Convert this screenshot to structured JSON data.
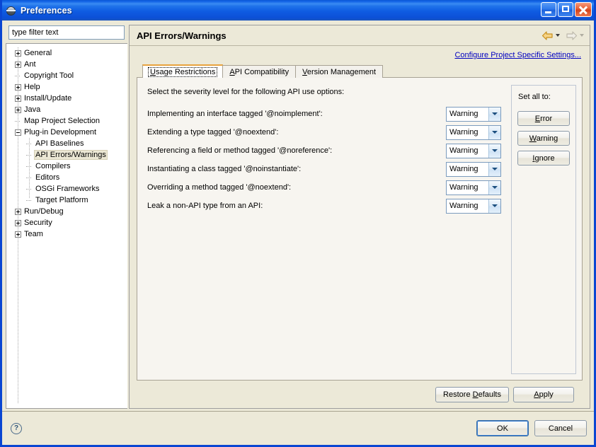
{
  "window": {
    "title": "Preferences",
    "icon": "globe-icon",
    "caption_buttons": {
      "minimize": "minimize-icon",
      "maximize": "maximize-icon",
      "close": "close-icon"
    }
  },
  "sidebar": {
    "filter": {
      "value": "type filter text",
      "placeholder": "type filter text"
    },
    "items": [
      {
        "label": "General",
        "level": 0,
        "expander": "plus",
        "selected": false
      },
      {
        "label": "Ant",
        "level": 0,
        "expander": "plus",
        "selected": false
      },
      {
        "label": "Copyright Tool",
        "level": 0,
        "expander": "none",
        "selected": false
      },
      {
        "label": "Help",
        "level": 0,
        "expander": "plus",
        "selected": false
      },
      {
        "label": "Install/Update",
        "level": 0,
        "expander": "plus",
        "selected": false
      },
      {
        "label": "Java",
        "level": 0,
        "expander": "plus",
        "selected": false
      },
      {
        "label": "Map Project Selection",
        "level": 0,
        "expander": "none",
        "selected": false
      },
      {
        "label": "Plug-in Development",
        "level": 0,
        "expander": "minus",
        "selected": false
      },
      {
        "label": "API Baselines",
        "level": 1,
        "expander": "none",
        "selected": false
      },
      {
        "label": "API Errors/Warnings",
        "level": 1,
        "expander": "none",
        "selected": true
      },
      {
        "label": "Compilers",
        "level": 1,
        "expander": "none",
        "selected": false
      },
      {
        "label": "Editors",
        "level": 1,
        "expander": "none",
        "selected": false
      },
      {
        "label": "OSGi Frameworks",
        "level": 1,
        "expander": "none",
        "selected": false
      },
      {
        "label": "Target Platform",
        "level": 1,
        "expander": "none",
        "selected": false
      },
      {
        "label": "Run/Debug",
        "level": 0,
        "expander": "plus",
        "selected": false
      },
      {
        "label": "Security",
        "level": 0,
        "expander": "plus",
        "selected": false
      },
      {
        "label": "Team",
        "level": 0,
        "expander": "plus",
        "selected": false
      }
    ]
  },
  "page": {
    "title": "API Errors/Warnings",
    "nav": {
      "back_icon": "back-arrow-icon",
      "back_menu_icon": "chevron-down-icon",
      "forward_icon": "forward-arrow-icon",
      "forward_menu_icon": "chevron-down-icon"
    },
    "configure_link": "Configure Project Specific Settings...",
    "tabs": [
      {
        "label": "Usage Restrictions",
        "mnemonic": "U",
        "active": true
      },
      {
        "label": "API Compatibility",
        "mnemonic": "A",
        "active": false
      },
      {
        "label": "Version Management",
        "mnemonic": "V",
        "active": false
      }
    ],
    "section_note": "Select the severity level for the following API use options:",
    "options": [
      {
        "label": "Implementing an interface tagged '@noimplement':",
        "value": "Warning"
      },
      {
        "label": "Extending a type tagged '@noextend':",
        "value": "Warning"
      },
      {
        "label": "Referencing a field or method tagged '@noreference':",
        "value": "Warning"
      },
      {
        "label": "Instantiating a class tagged '@noinstantiate':",
        "value": "Warning"
      },
      {
        "label": "Overriding a method tagged '@noextend':",
        "value": "Warning"
      },
      {
        "label": "Leak a non-API type from an API:",
        "value": "Warning"
      }
    ],
    "severity_options": [
      "Error",
      "Warning",
      "Ignore"
    ],
    "set_all": {
      "title": "Set all to:",
      "buttons": [
        {
          "label": "Error",
          "mnemonic": "E"
        },
        {
          "label": "Warning",
          "mnemonic": "W"
        },
        {
          "label": "Ignore",
          "mnemonic": "I"
        }
      ]
    },
    "footer_buttons": [
      {
        "label": "Restore Defaults",
        "mnemonic": "D"
      },
      {
        "label": "Apply",
        "mnemonic": "A"
      }
    ]
  },
  "dialog_footer": {
    "help_icon": "help-question-icon",
    "help_glyph": "?",
    "ok": "OK",
    "cancel": "Cancel"
  },
  "colors": {
    "titlebar_blue": "#0c4fd6",
    "window_border": "#0a46d2",
    "dialog_bg": "#ece9d8",
    "tab_body_bg": "#f7f5f0",
    "active_tab_accent": "#e8a33d",
    "link": "#0000c0",
    "tree_selection": "#ebe7d4",
    "combo_border": "#7b9bbd",
    "back_arrow": "#e0a526",
    "forward_arrow_disabled": "#cfcabb"
  }
}
